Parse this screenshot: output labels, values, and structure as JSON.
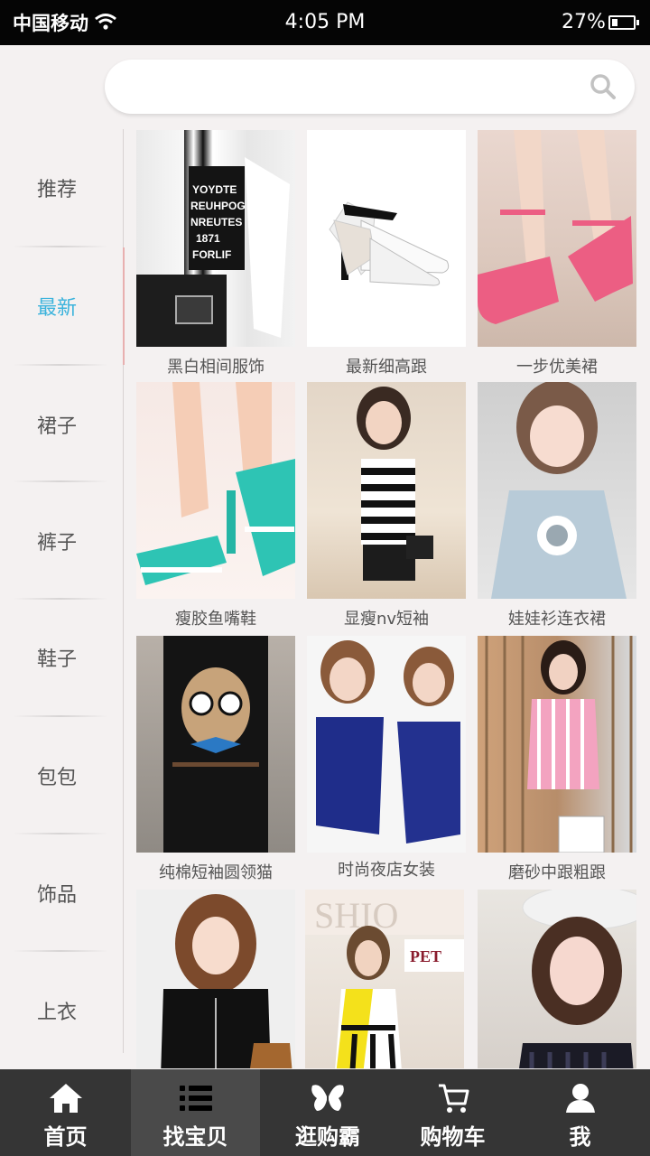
{
  "status_bar": {
    "carrier": "中国移动",
    "time": "4:05 PM",
    "battery": "27%",
    "battery_level": 0.27
  },
  "search": {
    "placeholder": "",
    "icon": "search-icon"
  },
  "sidebar": {
    "active_color": "#3bb3dc",
    "items": [
      {
        "label": "推荐"
      },
      {
        "label": "最新"
      },
      {
        "label": "裙子"
      },
      {
        "label": "裤子"
      },
      {
        "label": "鞋子"
      },
      {
        "label": "包包"
      },
      {
        "label": "饰品"
      },
      {
        "label": "上衣"
      }
    ]
  },
  "products": [
    {
      "caption": "黑白相间服饰"
    },
    {
      "caption": "最新细高跟"
    },
    {
      "caption": "一步优美裙"
    },
    {
      "caption": "瘦胶鱼嘴鞋"
    },
    {
      "caption": "显瘦nv短袖"
    },
    {
      "caption": "娃娃衫连衣裙"
    },
    {
      "caption": "纯棉短袖圆领猫"
    },
    {
      "caption": "时尚夜店女装"
    },
    {
      "caption": "磨砂中跟粗跟"
    },
    {
      "caption": ""
    },
    {
      "caption": ""
    },
    {
      "caption": ""
    }
  ],
  "bottom_nav": {
    "active_color": "#39b7d9",
    "items": [
      {
        "label": "首页",
        "icon": "home-icon"
      },
      {
        "label": "找宝贝",
        "icon": "list-icon"
      },
      {
        "label": "逛购霸",
        "icon": "butterfly-icon"
      },
      {
        "label": "购物车",
        "icon": "cart-icon"
      },
      {
        "label": "我",
        "icon": "user-icon"
      }
    ]
  }
}
